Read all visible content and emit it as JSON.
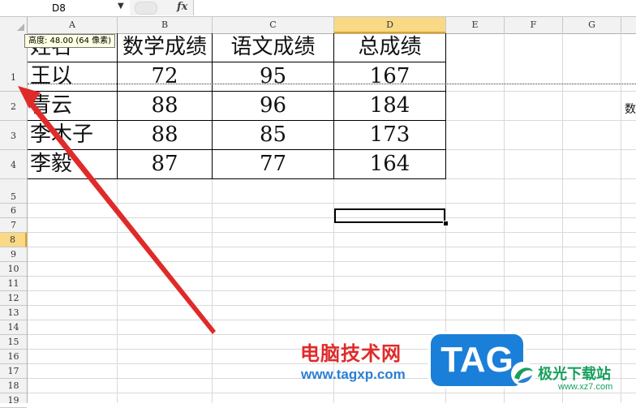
{
  "namebox": {
    "value": "D8"
  },
  "formula": {
    "fx_label": "fx",
    "content": ""
  },
  "columns": [
    "A",
    "B",
    "C",
    "D",
    "E",
    "F",
    "G"
  ],
  "active_column": "D",
  "rows": [
    "1",
    "2",
    "3",
    "4",
    "5",
    "6",
    "7",
    "8",
    "9",
    "10",
    "11",
    "12",
    "13",
    "14",
    "15",
    "16",
    "17",
    "18",
    "19"
  ],
  "active_row": "8",
  "table": {
    "headers": [
      "姓名",
      "数学成绩",
      "语文成绩",
      "总成绩"
    ],
    "rows": [
      [
        "王以",
        "72",
        "95",
        "167"
      ],
      [
        "青云",
        "88",
        "96",
        "184"
      ],
      [
        "李木子",
        "88",
        "85",
        "173"
      ],
      [
        "李毅",
        "87",
        "77",
        "164"
      ]
    ]
  },
  "tooltip": {
    "text": "高度: 48.00 (64 像素)"
  },
  "stray_text": "数",
  "colors": {
    "accent_header": "#f9d986",
    "arrow": "#e02a2a",
    "watermark_blue": "#1a7fd8",
    "watermark_green": "#17a05d"
  },
  "watermark": {
    "brand": "电脑技术网",
    "url": "www.tagxp.com",
    "tag": "TAG",
    "site_name": "极光下载站",
    "site_url": "www.xz7.com"
  }
}
